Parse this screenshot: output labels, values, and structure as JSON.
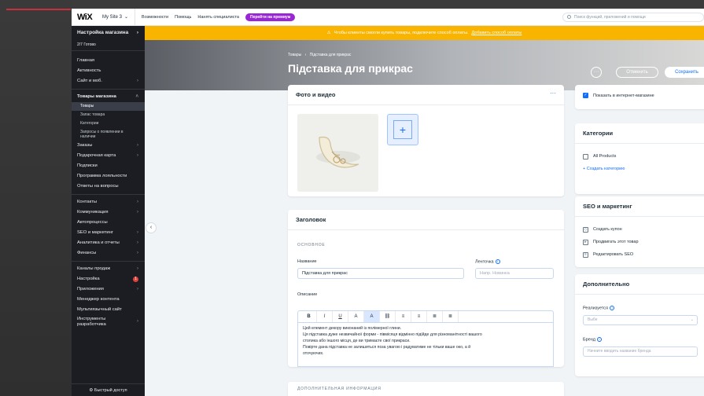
{
  "topbar": {
    "logo": "WiX",
    "site": "My Site 3",
    "links": [
      "Возможности",
      "Помощь",
      "Нанять специалиста"
    ],
    "upgrade": "Перейти на премиум",
    "search_placeholder": "Поиск функций, приложений и помощи"
  },
  "sidebar": {
    "header": "Настройка магазина",
    "progress": "2/7 Готово",
    "items_top": [
      "Главная",
      "Активность",
      "Сайт и моб."
    ],
    "store_header": "Товары магазина",
    "store_subitems": [
      "Товары",
      "Запас товара",
      "Категории"
    ],
    "store_sub_request": "Запросы о появлении в наличии",
    "items_mid": [
      "Заказы",
      "Подарочная карта",
      "Подписки",
      "Программа лояльности",
      "Ответы на вопросы"
    ],
    "items_low": [
      "Контакты",
      "Коммуникация",
      "Автопроцессы",
      "SEO и маркетинг",
      "Аналитика и отчеты",
      "Финансы"
    ],
    "items_bottom": [
      "Каналы продаж",
      "Настройка",
      "Приложения",
      "Менеджер контента",
      "Мультиязычный сайт",
      "Инструменты разработчика"
    ],
    "settings_badge": "1",
    "footer": "Быстрый доступ"
  },
  "notice": {
    "text": "Чтобы клиенты смогли купить товары, подключите способ оплаты.",
    "link": "Добавить способ оплаты"
  },
  "header": {
    "breadcrumb_root": "Товары",
    "breadcrumb_sep": "›",
    "breadcrumb_current": "Підставка для прикрас",
    "title": "Підставка для прикрас",
    "more": "···",
    "cancel": "Отменить",
    "save": "Сохранить"
  },
  "photo_card": {
    "title": "Фото и видео",
    "menu": "···",
    "add": "+"
  },
  "main_card": {
    "title": "Заголовок",
    "section": "ОСНОВНОЕ",
    "name_label": "Название",
    "name_value": "Підставка для прикрас",
    "ribbon_label": "Ленточка",
    "ribbon_placeholder": "Напр. Новинка",
    "desc_label": "Описание",
    "toolbar": [
      "B",
      "I",
      "U",
      "A",
      "A",
      "⛓",
      "≡",
      "≡",
      "≣",
      "≣"
    ],
    "desc_lines": [
      "Цей елемент декору виконаний із полімерної глини.",
      "Ця підставка дуже незвичайної форми - півмісяця відмінно підійде для різноманітності вашого",
      "столика або іншого місця, де ви тримаєте свої прикраси.",
      "Повірте дана підставка не залишиться поза увагою і радуватиме не тільки ваше око, а й",
      "оточуючих."
    ]
  },
  "more_card": {
    "section": "ДОПОЛНИТЕЛЬНАЯ ИНФОРМАЦИЯ"
  },
  "right": {
    "show_online": "Показать в интернет-магазине",
    "categories_title": "Категории",
    "category": "All Products",
    "create_category": "+ Создать категорию",
    "seo_title": "SEO и маркетинг",
    "seo_items": [
      "Создать купон",
      "Продвигать этот товар",
      "Редактировать SEO"
    ],
    "extra_title": "Дополнительно",
    "sold_by": "Реализуется",
    "sold_by_placeholder": "Выбе",
    "brand_label": "Бренд",
    "brand_placeholder": "Начните вводить название бренда"
  }
}
